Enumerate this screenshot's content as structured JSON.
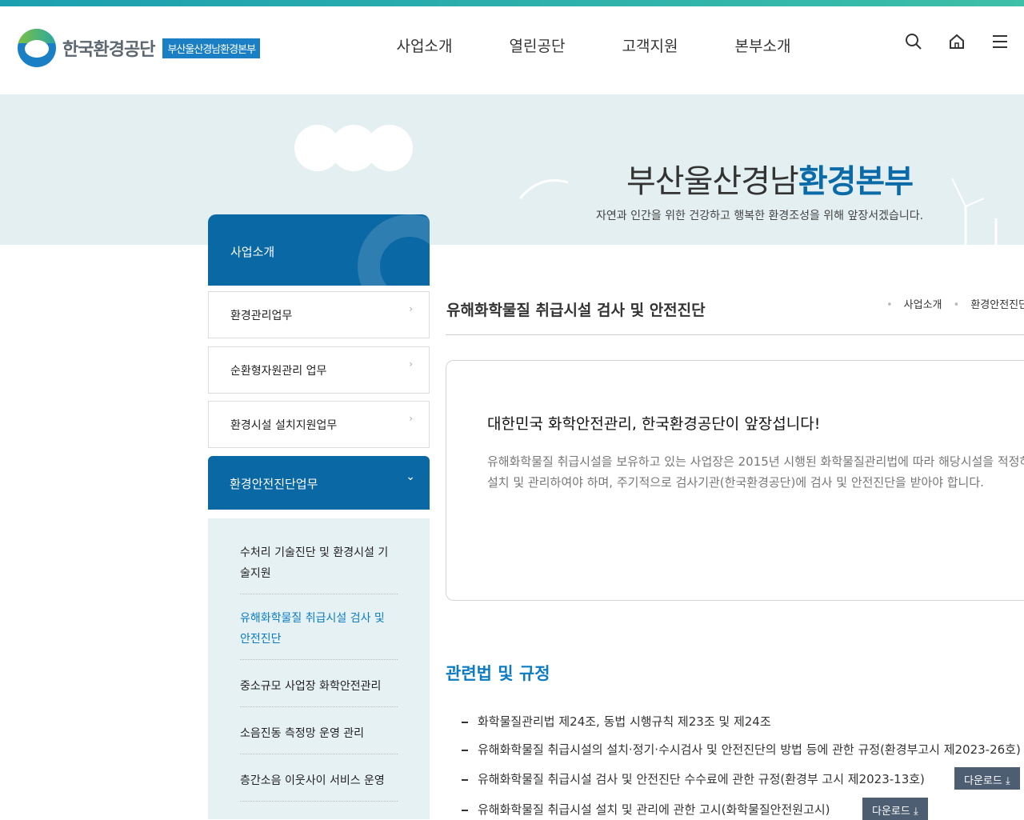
{
  "header": {
    "logo_name": "한국환경공단",
    "logo_badge": "부산울산경남환경본부",
    "nav": [
      "사업소개",
      "열린공단",
      "고객지원",
      "본부소개"
    ]
  },
  "visual": {
    "title_main": "부산울산경남",
    "title_accent": "환경본부",
    "subtitle": "자연과 인간을 위한 건강하고 행복한 환경조성을 위해 앞장서겠습니다."
  },
  "lnb": {
    "title": "사업소개",
    "items": [
      "환경관리업무",
      "순환형자원관리 업무",
      "환경시설 설치지원업무"
    ],
    "active": "환경안전진단업무",
    "sub_items": [
      "수처리 기술진단 및 환경시설 기술지원",
      "유해화학물질 취급시설 검사 및 안전진단",
      "중소규모 사업장 화학안전관리",
      "소음진동 측정망 운영 관리",
      "층간소음 이웃사이 서비스 운영"
    ]
  },
  "content": {
    "page_title": "유해화학물질 취급시설 검사 및 안전진단",
    "breadcrumb": [
      "사업소개",
      "환경안전진단"
    ],
    "box_heading": "대한민국 화학안전관리, 한국환경공단이 앞장섭니다!",
    "box_text": "유해화학물질 취급시설을 보유하고 있는 사업장은 2015년 시행된 화학물질관리법에 따라 해당시설을 적정하게 설치 및 관리하여야 하며, 주기적으로 검사기관(한국환경공단)에 검사 및 안전진단을 받아야 합니다.",
    "section_title": "관련법 및 규정",
    "laws": [
      "화학물질관리법 제24조, 동법 시행규칙 제23조 및 제24조",
      "유해화학물질 취급시설의 설치·정기·수시검사 및 안전진단의 방법 등에 관한 규정(환경부고시 제2023-26호)",
      "유해화학물질 취급시설 검사 및 안전진단 수수료에 관한 규정(환경부 고시 제2023-13호)",
      "유해화학물질 취급시설 설치 및 관리에 관한 고시(화학물질안전원고시)"
    ],
    "download_label": "다운로드"
  }
}
